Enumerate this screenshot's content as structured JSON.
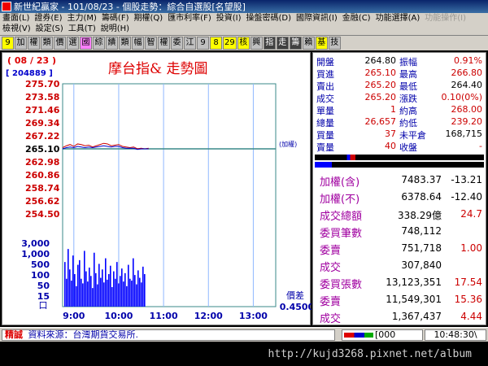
{
  "window": {
    "title": "新世紀贏家 - 101/08/23 - 個股走勢：綜合自選股[名望股]"
  },
  "menu": {
    "row1": [
      "畫面(L)",
      "證券(E)",
      "主力(M)",
      "籌碼(F)",
      "期權(Q)",
      "匯市利率(F)",
      "投資(I)",
      "操盤密碼(D)",
      "國際資訊(I)",
      "金融(C)",
      "功能選擇(A)",
      "功能操作(I)"
    ],
    "row2": [
      "檢視(V)",
      "設定(S)",
      "工具(T)",
      "說明(H)"
    ]
  },
  "toolbar": {
    "items": [
      "9",
      "加",
      "權",
      "類",
      "價",
      "選",
      "國",
      "綜",
      "績",
      "類",
      "幅",
      "智",
      "權",
      "委",
      "江",
      "9",
      "8",
      "29",
      "核",
      "興",
      "指",
      "走",
      "籌",
      "賴",
      "基",
      "技"
    ]
  },
  "chart": {
    "date": "( 08 / 23 )",
    "code": "[ 204889 ]",
    "title": "摩台指&  走勢圖",
    "weighted_label": "(加權)",
    "diff_label": "價差",
    "diff_value": "0.4500",
    "volume_marker": "口"
  },
  "chart_data": {
    "type": "line",
    "price_ticks": [
      "275.70",
      "273.58",
      "271.46",
      "269.34",
      "267.22",
      "265.10",
      "262.98",
      "260.86",
      "258.74",
      "256.62",
      "254.50"
    ],
    "price_ylim": [
      254.5,
      275.7
    ],
    "reference_price": 265.1,
    "volume_ticks": [
      "3,000",
      "1,000",
      "500",
      "100",
      "50",
      "15"
    ],
    "time_ticks": [
      "9:00",
      "10:00",
      "11:00",
      "12:00",
      "13:00"
    ],
    "xlim_minutes": [
      0,
      285
    ],
    "series": [
      {
        "name": "",
        "color": "#cc0000",
        "x": [
          0,
          5,
          10,
          15,
          20,
          25,
          30,
          35,
          40,
          45,
          50,
          55,
          60,
          65,
          70,
          75,
          80,
          85,
          90,
          95,
          100,
          105,
          110,
          115
        ],
        "y": [
          265.3,
          265.6,
          265.8,
          265.5,
          265.9,
          265.8,
          265.6,
          265.7,
          265.4,
          265.6,
          265.8,
          266.0,
          265.9,
          265.6,
          265.7,
          265.8,
          265.5,
          265.4,
          265.3,
          265.4,
          265.1,
          265.2,
          265.1,
          265.2
        ]
      },
      {
        "name": "",
        "color": "#0000cc",
        "x": [
          0,
          5,
          10,
          15,
          20,
          25,
          30,
          35,
          40,
          45,
          50,
          55,
          60,
          65,
          70,
          75,
          80,
          85,
          90,
          95,
          100,
          105,
          110,
          115
        ],
        "y": [
          265.1,
          265.3,
          265.4,
          265.3,
          265.5,
          265.4,
          265.3,
          265.4,
          265.3,
          265.4,
          265.5,
          265.6,
          265.5,
          265.4,
          265.5,
          265.5,
          265.3,
          265.2,
          265.2,
          265.2,
          265.0,
          265.1,
          265.1,
          265.1
        ]
      }
    ],
    "volume_bars": [
      48,
      30,
      62,
      40,
      28,
      55,
      35,
      22,
      45,
      50,
      30,
      25,
      60,
      38,
      27,
      42,
      33,
      20,
      58,
      36,
      24,
      46,
      31,
      40,
      26,
      52,
      29,
      35,
      44,
      21,
      38,
      30,
      48,
      25,
      33,
      41,
      27,
      36,
      22,
      45,
      30,
      28,
      52,
      34,
      24,
      39,
      31,
      26,
      43,
      35
    ]
  },
  "quote": {
    "rows": [
      {
        "k1": "開盤",
        "v1": "264.80",
        "k2": "振幅",
        "v2": "0.91%",
        "c1": "#000000",
        "c2": "#cc0000"
      },
      {
        "k1": "買進",
        "v1": "265.10",
        "k2": "最高",
        "v2": "266.80",
        "c1": "#cc0000",
        "c2": "#cc0000"
      },
      {
        "k1": "賣出",
        "v1": "265.20",
        "k2": "最低",
        "v2": "264.40",
        "c1": "#cc0000",
        "c2": "#000000"
      },
      {
        "k1": "成交",
        "v1": "265.20",
        "k2": "漲跌",
        "v2": "0.10(0%)",
        "c1": "#cc0000",
        "c2": "#cc0000"
      },
      {
        "k1": "單量",
        "v1": "1",
        "k2": "約高",
        "v2": "268.00",
        "c1": "#cc0000",
        "c2": "#cc0000"
      },
      {
        "k1": "總量",
        "v1": "26,657",
        "k2": "約低",
        "v2": "239.20",
        "c1": "#cc0000",
        "c2": "#cc0000"
      },
      {
        "k1": "買量",
        "v1": "37",
        "k2": "未平倉",
        "v2": "168,715",
        "c1": "#cc0000",
        "c2": "#000000"
      },
      {
        "k1": "賣量",
        "v1": "40",
        "k2": "收盤",
        "v2": "-",
        "c1": "#cc0000",
        "c2": "#cc0000"
      }
    ],
    "stats": [
      {
        "k": "加權(含)",
        "v1": "7483.37",
        "v2": "-13.21",
        "v2color": "#000000"
      },
      {
        "k": "加權(不)",
        "v1": "6378.64",
        "v2": "-12.40",
        "v2color": "#000000"
      },
      {
        "k": "成交總額",
        "v1": "338.29億",
        "v2": "24.7",
        "v2color": "#cc0000"
      },
      {
        "k": "委買筆數",
        "v1": "748,112",
        "v2": "",
        "v2color": "#cc0000"
      },
      {
        "k": "委賣",
        "v1": "751,718",
        "v2": "1.00",
        "v2color": "#cc0000"
      },
      {
        "k": "成交",
        "v1": "307,840",
        "v2": "",
        "v2color": "#cc0000"
      },
      {
        "k": "委買張數",
        "v1": "13,123,351",
        "v2": "17.54",
        "v2color": "#cc0000"
      },
      {
        "k": "委賣",
        "v1": "11,549,301",
        "v2": "15.36",
        "v2color": "#cc0000"
      },
      {
        "k": "成交",
        "v1": "1,367,437",
        "v2": "4.44",
        "v2color": "#cc0000"
      }
    ]
  },
  "status": {
    "tag": "精誠",
    "message": "資料來源：台灣期貨交易所.",
    "box": "[000",
    "clock": "10:48:30\\"
  },
  "watermark": "http://kujd3268.pixnet.net/album"
}
